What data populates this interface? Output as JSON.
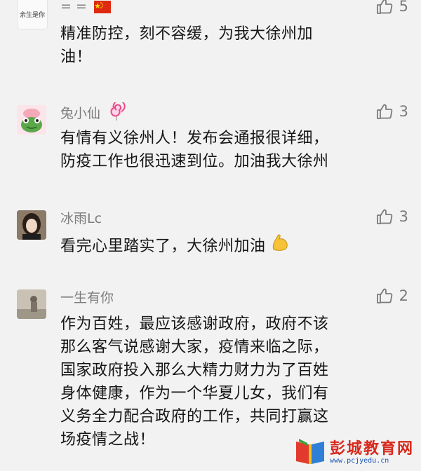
{
  "comments": [
    {
      "name": "= =",
      "avatar_text": "余生是你",
      "likes": "5",
      "lines": [
        "精准防控，刻不容缓，为我大徐州加",
        "油！"
      ]
    },
    {
      "name": "兔小仙",
      "likes": "3",
      "lines": [
        "有情有义徐州人！发布会通报很详细，",
        "防疫工作也很迅速到位。加油我大徐州"
      ]
    },
    {
      "name": "冰雨Lc",
      "likes": "3",
      "lines": [
        "看完心里踏实了，大徐州加油"
      ]
    },
    {
      "name": "一生有你",
      "likes": "2",
      "lines": [
        "作为百姓，最应该感谢政府，政府不该",
        "那么客气说感谢大家，疫情来临之际，",
        "国家政府投入那么大精力财力为了百姓",
        "身体健康，作为一个华夏儿女，我们有",
        "义务全力配合政府的工作，共同打赢这",
        "场疫情之战！"
      ]
    }
  ],
  "watermark": {
    "title": "彭城教育网",
    "url": "www.pcjyedu.cn"
  },
  "colors": {
    "background": "#f2f2f2",
    "name": "#7d7d7d",
    "text": "#161616",
    "like": "#7b7b7b"
  }
}
